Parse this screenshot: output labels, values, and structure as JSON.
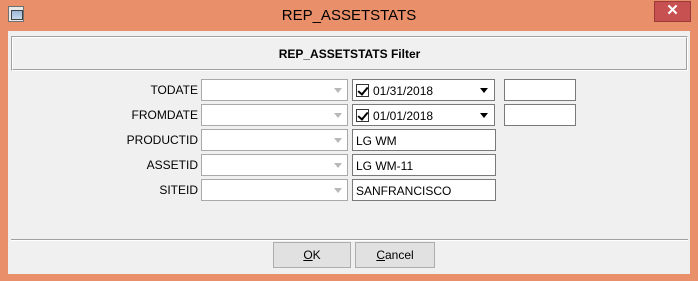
{
  "window": {
    "title": "REP_ASSETSTATS",
    "close_label": "✕"
  },
  "header": {
    "filter_title": "REP_ASSETSTATS Filter"
  },
  "fields": [
    {
      "label": "TODATE",
      "date_value": "01/31/2018",
      "checked": true
    },
    {
      "label": "FROMDATE",
      "date_value": "01/01/2018",
      "checked": true
    },
    {
      "label": "PRODUCTID",
      "text_value": "LG WM"
    },
    {
      "label": "ASSETID",
      "text_value": "LG WM-11"
    },
    {
      "label": "SITEID",
      "text_value": "SANFRANCISCO"
    }
  ],
  "buttons": {
    "ok_first": "O",
    "ok_rest": "K",
    "cancel_first": "C",
    "cancel_rest": "ancel"
  }
}
